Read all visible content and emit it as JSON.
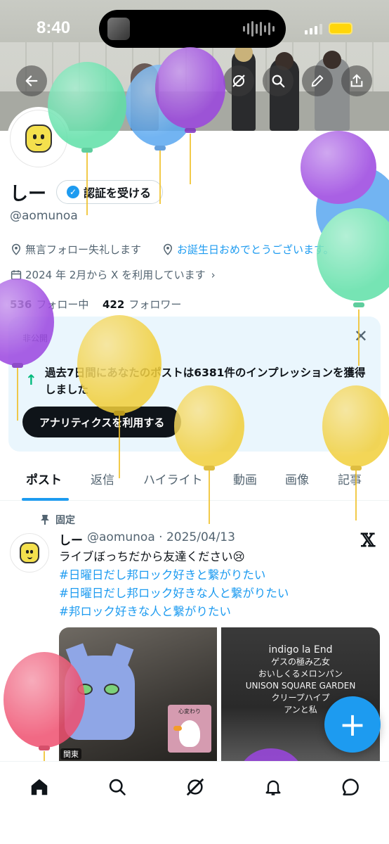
{
  "status_bar": {
    "time": "8:40"
  },
  "profile": {
    "name": "しー",
    "verify_label": "認証を受ける",
    "handle": "@aomunoa",
    "bio_location": "無言フォロー失礼します",
    "bio_link": "お誕生日おめでとうございます。",
    "joined": "2024 年 2月から X を利用しています",
    "following_count": "536",
    "following_label": "フォロー中",
    "followers_count": "422",
    "followers_label": "フォロワー"
  },
  "analytics_card": {
    "private_label": "非公開",
    "message": "過去7日間にあなたのポストは6381件のインプレッションを獲得しました",
    "cta_label": "アナリティクスを利用する"
  },
  "tabs": [
    "ポスト",
    "返信",
    "ハイライト",
    "動画",
    "画像",
    "記事"
  ],
  "post": {
    "pinned_label": "固定",
    "author_name": "しー",
    "author_handle_date": "@aomunoa · 2025/04/13",
    "text": "ライブぼっちだから友達ください😢",
    "hashtags": [
      "#日曜日だし邦ロック好きと繋がりたい",
      "#日曜日だし邦ロック好きな人と繋がりたい",
      "#邦ロック好きな人と繋がりたい"
    ],
    "media_right_lines": [
      "indigo la End",
      "ゲスの極み乙女",
      "おいしくるメロンパン",
      "UNISON SQUARE GARDEN",
      "クリープハイプ",
      "アンと私"
    ],
    "media_left_badge": "関東",
    "media_left_sticker": "心変わり"
  },
  "fab_label": "+",
  "colors": {
    "accent": "#1d9bf0",
    "text_primary": "#0f1419",
    "text_secondary": "#536471",
    "card_bg": "#eaf6fd",
    "balloon_green": "#5fe0a8",
    "balloon_blue": "#5aa8f0",
    "balloon_purple": "#9b45e0",
    "balloon_yellow": "#f2cf3a",
    "balloon_pink": "#ef4f6f"
  },
  "icons": {
    "top_buttons": [
      "back-arrow-icon",
      "grok-icon",
      "search-icon",
      "edit-pencil-icon",
      "share-icon"
    ],
    "bottom_nav": [
      "home-icon",
      "search-icon",
      "grok-icon",
      "notifications-bell-icon",
      "messages-icon"
    ]
  }
}
